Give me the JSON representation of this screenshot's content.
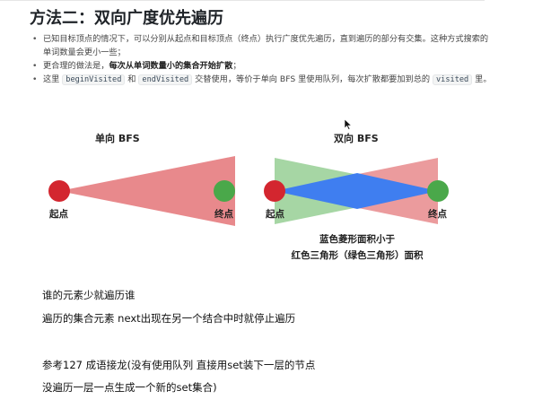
{
  "title": "方法二：双向广度优先遍历",
  "bullets": [
    {
      "text": "已知目标顶点的情况下，可以分别从起点和目标顶点（终点）执行广度优先遍历，直到遍历的部分有交集。这种方式搜索的单词数量会更小一些；"
    },
    {
      "pre": "更合理的做法是，",
      "bold": "每次从单词数量小的集合开始扩散",
      "post": "；"
    },
    {
      "pre": "这里 ",
      "code1": "beginVisited",
      "mid1": " 和 ",
      "code2": "endVisited",
      "mid2": " 交替使用，等价于单向 BFS 里使用队列，每次扩散都要加到总的 ",
      "code3": "visited",
      "post": " 里。"
    }
  ],
  "diagram": {
    "left_title": "单向 BFS",
    "right_title": "双向 BFS",
    "start_label": "起点",
    "end_label": "终点",
    "caption_line1": "蓝色菱形面积小于",
    "caption_line2": "红色三角形（绿色三角形）面积",
    "colors": {
      "red_triangle": "#e8898c",
      "green_triangle": "#a6d6a4",
      "blue_diamond": "#3f7ef0",
      "red_node": "#d3262f",
      "green_node": "#4aa84a"
    }
  },
  "notes": [
    "谁的元素少就遍历谁",
    "遍历的集合元素 next出现在另一个结合中时就停止遍历",
    "参考127 成语接龙(没有使用队列 直接用set装下一层的节点",
    "没遍历一层一点生成一个新的set集合)"
  ]
}
